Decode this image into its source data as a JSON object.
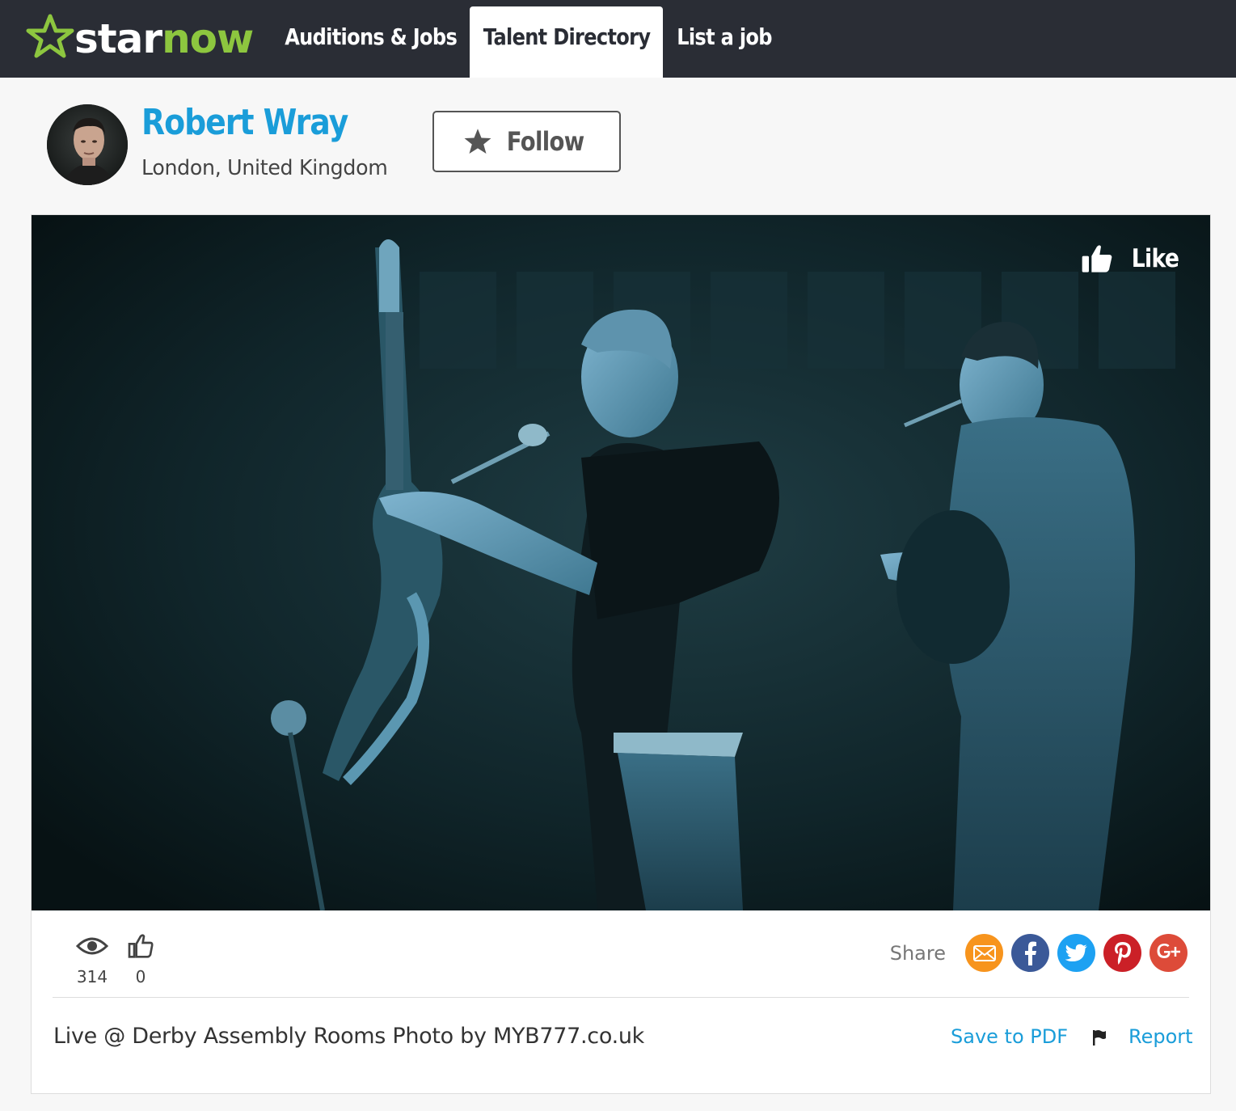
{
  "nav": {
    "logo": {
      "word_star": "star",
      "word_now": "now",
      "icon": "star-outline-icon",
      "brand_green": "#8dc63f"
    },
    "links": [
      {
        "label": "Auditions & Jobs",
        "active": false
      },
      {
        "label": "Talent Directory",
        "active": true
      },
      {
        "label": "List a job",
        "active": false
      }
    ]
  },
  "profile": {
    "name": "Robert Wray",
    "location": "London, United Kingdom",
    "follow_label": "Follow",
    "name_color": "#1a9dd9"
  },
  "photo": {
    "like_label": "Like",
    "caption": "Live @ Derby Assembly Rooms Photo by MYB777.co.uk"
  },
  "stats": {
    "views": "314",
    "likes": "0"
  },
  "share": {
    "label": "Share",
    "buttons": [
      {
        "name": "email",
        "icon": "envelope-icon",
        "color": "#f7941d"
      },
      {
        "name": "facebook",
        "icon": "facebook-icon",
        "color": "#3b5998"
      },
      {
        "name": "twitter",
        "icon": "twitter-icon",
        "color": "#1da1f2"
      },
      {
        "name": "pinterest",
        "icon": "pinterest-icon",
        "color": "#cb2027"
      },
      {
        "name": "google-plus",
        "icon": "google-plus-icon",
        "color": "#dd4b39"
      }
    ]
  },
  "actions": {
    "save_pdf": "Save to PDF",
    "report": "Report"
  }
}
